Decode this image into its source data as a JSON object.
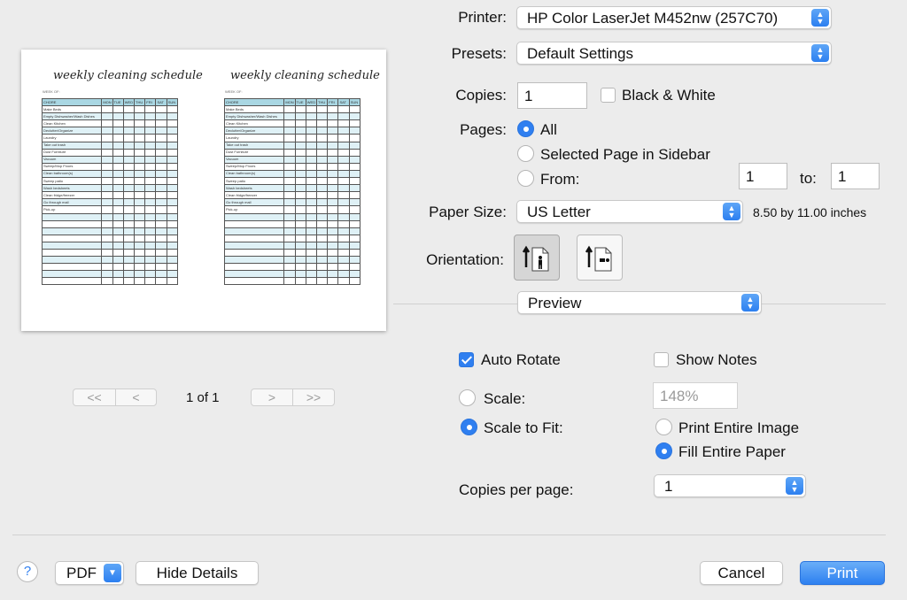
{
  "printer": {
    "label": "Printer:",
    "value": "HP Color LaserJet M452nw (257C70)"
  },
  "presets": {
    "label": "Presets:",
    "value": "Default Settings"
  },
  "copies": {
    "label": "Copies:",
    "value": "1",
    "bw_label": "Black & White",
    "bw_checked": false
  },
  "pages": {
    "label": "Pages:",
    "options": {
      "all": "All",
      "selected": "Selected Page in Sidebar",
      "from": "From:"
    },
    "selected": "all",
    "from_value": "1",
    "to_label": "to:",
    "to_value": "1"
  },
  "paper_size": {
    "label": "Paper Size:",
    "value": "US Letter",
    "dimensions": "8.50 by 11.00 inches"
  },
  "orientation": {
    "label": "Orientation:",
    "selected": "portrait",
    "icons": [
      "portrait-icon",
      "landscape-icon"
    ]
  },
  "section": {
    "value": "Preview"
  },
  "preview_options": {
    "auto_rotate": {
      "label": "Auto Rotate",
      "checked": true
    },
    "show_notes": {
      "label": "Show Notes",
      "checked": false
    },
    "scale": {
      "label": "Scale:",
      "value": "148%"
    },
    "scale_to_fit": {
      "label": "Scale to Fit:"
    },
    "scale_mode": "scale_to_fit",
    "print_entire_image": {
      "label": "Print Entire Image"
    },
    "fill_entire_paper": {
      "label": "Fill Entire Paper"
    },
    "fit_mode": "fill_entire_paper",
    "copies_per_page": {
      "label": "Copies per page:",
      "value": "1"
    }
  },
  "page_nav": {
    "first": "<<",
    "prev": "<",
    "next": ">",
    "last": ">>",
    "indicator": "1 of 1"
  },
  "thumbnail": {
    "title": "weekly cleaning schedule",
    "subtitle": "WEEK OF:",
    "columns": [
      "CHORE",
      "MON",
      "TUE",
      "WED",
      "THU",
      "FRI",
      "SAT",
      "SUN"
    ],
    "chores": [
      "Make Beds",
      "Empty Dishwasher/Wash Dishes",
      "Clean Kitchen",
      "Declutter/Organize",
      "Laundry",
      "Take out trash",
      "Dust Furniture",
      "Vacuum",
      "Sweep/Mop Floors",
      "Clean bathroom(s)",
      "Sweep patio",
      "Wash bedsheets",
      "Clean fridge/freezer",
      "Go through mail",
      "Pick-up"
    ],
    "total_rows": 25
  },
  "footer": {
    "help": "?",
    "pdf": "PDF",
    "hide_details": "Hide Details",
    "cancel": "Cancel",
    "print": "Print"
  },
  "colors": {
    "accent": "#2f7ff0",
    "table_header": "#a9d7e3",
    "table_alt": "#dff1f6"
  }
}
